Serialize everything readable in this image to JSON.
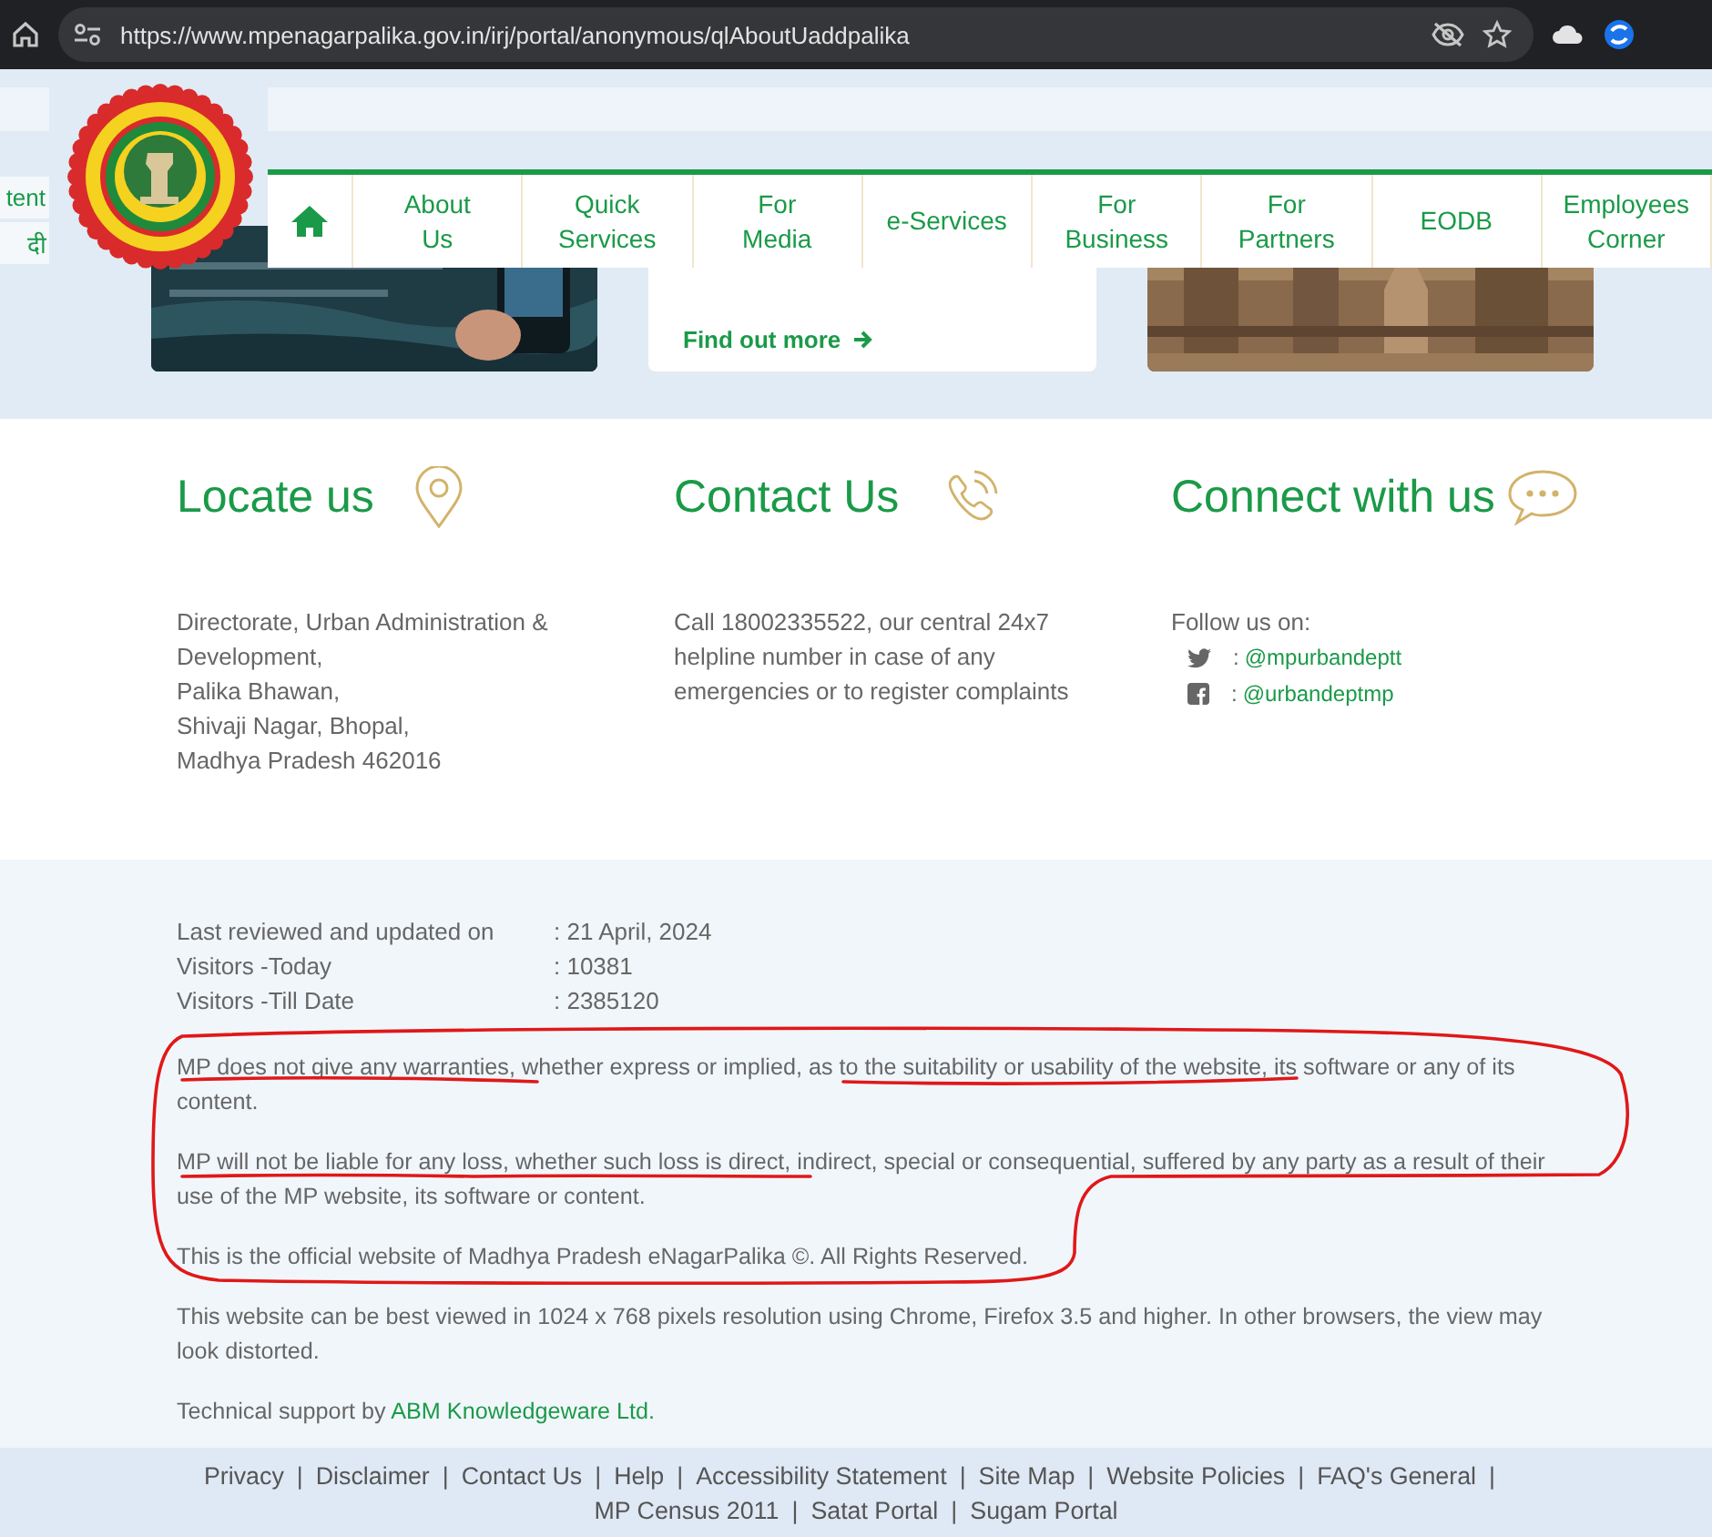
{
  "browser": {
    "url": "https://www.mpenagarpalika.gov.in/irj/portal/anonymous/qlAboutUaddpalika"
  },
  "side_buttons": [
    "tent",
    "दी"
  ],
  "nav": {
    "items": [
      {
        "label": "About\nUs"
      },
      {
        "label": "Quick\nServices"
      },
      {
        "label": "For\nMedia"
      },
      {
        "label": "e-Services"
      },
      {
        "label": "For\nBusiness"
      },
      {
        "label": "For\nPartners"
      },
      {
        "label": "EODB"
      },
      {
        "label": "Employees\nCorner"
      }
    ]
  },
  "banner": {
    "link": "Find out more"
  },
  "contact_columns": [
    {
      "kind": "locate",
      "title": "Locate us",
      "text": "Directorate, Urban Administration & Development,\nPalika Bhawan,\nShivaji Nagar, Bhopal,\nMadhya Pradesh 462016"
    },
    {
      "kind": "contact",
      "title": "Contact Us",
      "text": "Call 18002335522, our central 24x7 helpline number in case of any emergencies or to register complaints"
    },
    {
      "kind": "connect",
      "title": "Connect with us",
      "text": "Follow us on:",
      "links": [
        {
          "kind": "twitter",
          "separator": ":",
          "handle": "@mpurbandeptt"
        },
        {
          "kind": "facebook",
          "separator": ":",
          "handle": "@urbandeptmp"
        }
      ]
    }
  ],
  "info_rows": [
    {
      "label": "Last reviewed and updated on",
      "value": ": 21 April, 2024"
    },
    {
      "label": "Visitors -Today",
      "value": ": 10381"
    },
    {
      "label": "Visitors -Till Date",
      "value": ": 2385120"
    }
  ],
  "disclaimers": [
    "MP does not give any warranties, whether express or implied, as to the suitability or usability of the website, its software or any of its content.",
    "MP will not be liable for any loss, whether such loss is direct, indirect, special or consequential, suffered by any party as a result of their use of the MP website, its software or content.",
    "This is the official website of Madhya Pradesh eNagarPalika ©. All Rights Reserved."
  ],
  "note": "This website can be best viewed in 1024 x 768 pixels resolution using Chrome, Firefox 3.5 and higher. In other browsers, the view may look distorted.",
  "support": {
    "text": "Technical support by",
    "link": "ABM Knowledgeware Ltd."
  },
  "footer_links": [
    {
      "label": "Privacy",
      "separator": "|"
    },
    {
      "label": "Disclaimer",
      "separator": "|"
    },
    {
      "label": "Contact Us",
      "separator": "|"
    },
    {
      "label": "Help",
      "separator": "|"
    },
    {
      "label": "Accessibility Statement",
      "separator": "|"
    },
    {
      "label": "Site Map",
      "separator": "|"
    },
    {
      "label": "Website Policies",
      "separator": "|"
    },
    {
      "label": "FAQ's General",
      "separator": "|"
    },
    {
      "label": "MP Census 2011",
      "separator": "|"
    },
    {
      "label": "Satat Portal",
      "separator": "|"
    },
    {
      "label": "Sugam Portal"
    }
  ]
}
